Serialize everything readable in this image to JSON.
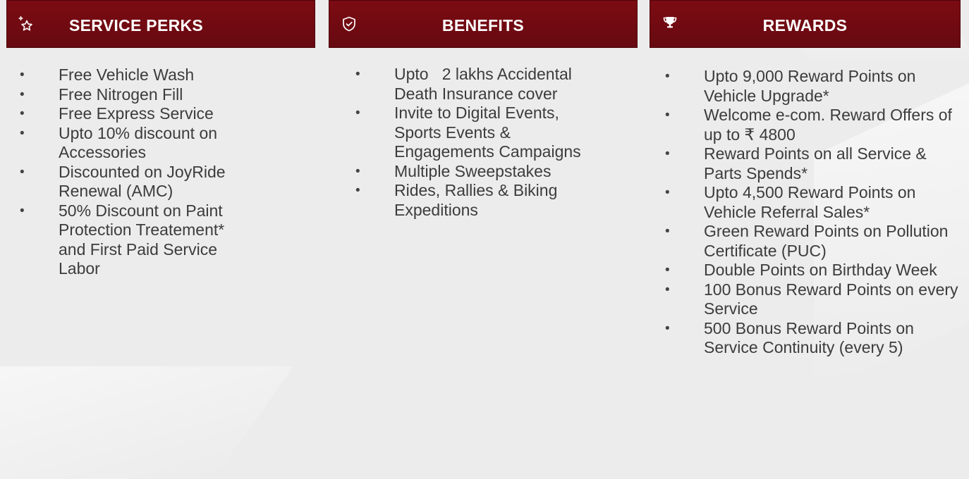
{
  "columns": [
    {
      "title": "SERVICE PERKS",
      "icon": "star-sparkle-icon",
      "items": [
        "Free Vehicle Wash",
        "Free Nitrogen Fill",
        "Free Express Service",
        "Upto 10% discount on Accessories",
        "Discounted on JoyRide Renewal (AMC)",
        "50% Discount on Paint Protection Treatement* and First Paid Service Labor"
      ]
    },
    {
      "title": "BENEFITS",
      "icon": "shield-check-icon",
      "items": [
        "Upto   2 lakhs Accidental Death Insurance cover",
        "Invite to Digital Events, Sports Events & Engagements Campaigns",
        "Multiple Sweepstakes",
        "Rides, Rallies & Biking Expeditions"
      ]
    },
    {
      "title": "REWARDS",
      "icon": "trophy-icon",
      "items": [
        "Upto 9,000 Reward Points on Vehicle Upgrade*",
        "Welcome e-com. Reward Offers of up to ₹ 4800",
        "Reward Points on all Service & Parts Spends*",
        "Upto 4,500 Reward Points on Vehicle Referral Sales*",
        "Green Reward Points on Pollution Certificate (PUC)",
        "Double Points on Birthday Week",
        "100 Bonus Reward Points on every Service",
        "500 Bonus Reward Points on Service Continuity (every 5)"
      ]
    }
  ],
  "colors": {
    "header_bg": "#720b12",
    "background": "#ececec",
    "text": "#3c3c3c",
    "header_text": "#ffffff"
  }
}
